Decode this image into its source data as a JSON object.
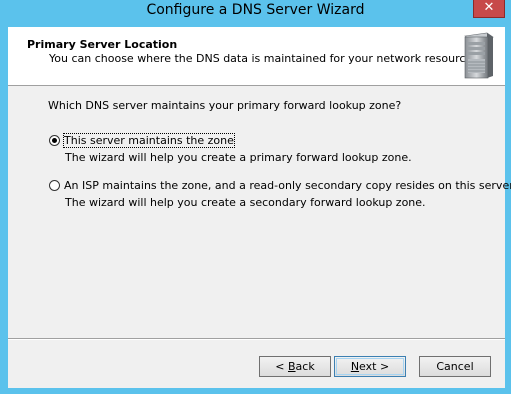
{
  "window": {
    "title": "Configure a DNS Server Wizard",
    "close_glyph": "✕"
  },
  "header": {
    "title": "Primary Server Location",
    "subtitle": "You can choose where the DNS data is maintained for your network resources.",
    "icon": "server-tower-icon"
  },
  "body": {
    "question": "Which DNS server maintains your primary forward lookup zone?",
    "options": [
      {
        "label": "This server maintains the zone",
        "description": "The wizard will help you create a primary forward lookup zone.",
        "checked": true
      },
      {
        "label": "An ISP maintains the zone, and a read-only secondary copy resides on this server",
        "description": "The wizard will help you create a secondary forward lookup zone.",
        "checked": false
      }
    ]
  },
  "buttons": {
    "back": {
      "prefix": "< ",
      "mnemonic": "B",
      "rest": "ack"
    },
    "next": {
      "mnemonic": "N",
      "rest": "ext >"
    },
    "cancel": "Cancel"
  },
  "colors": {
    "frame": "#5bc2ec",
    "close": "#c74a4a",
    "client": "#f0f0f0"
  }
}
